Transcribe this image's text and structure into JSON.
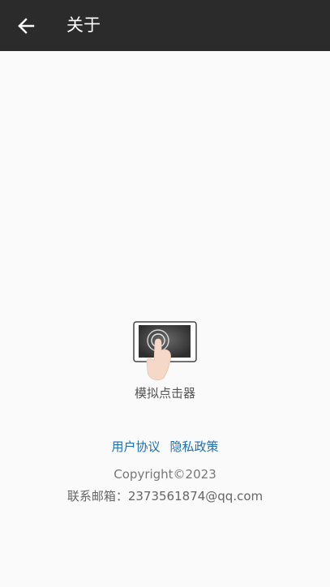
{
  "app_bar": {
    "title": "关于",
    "back_icon": "arrow-left-icon",
    "background": "#2b2b2b"
  },
  "about": {
    "logo_icon": "tap-screen-icon",
    "app_name": "模拟点击器",
    "user_agreement": "用户协议",
    "privacy_policy": "隐私政策",
    "copyright": "Copyright©2023",
    "contact": "联系邮箱：2373561874@qq.com",
    "link_color": "#1f6fb0"
  }
}
